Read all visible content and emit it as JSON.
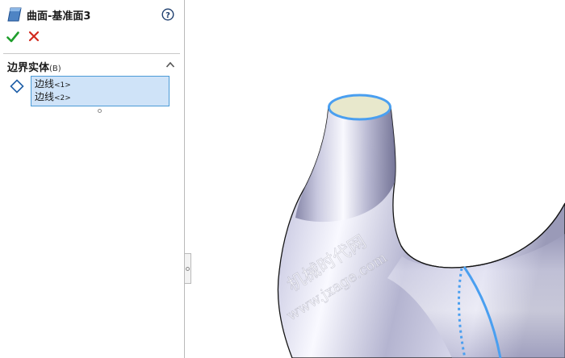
{
  "window": {
    "title": "曲面-基准面3",
    "help_icon": "question-circle-icon",
    "feature_icon": "surface-plane-icon"
  },
  "actions": {
    "ok_icon": "checkmark-icon",
    "ok_color": "#1f9e2c",
    "cancel_icon": "x-icon",
    "cancel_color": "#d22a1e"
  },
  "section": {
    "title": "边界实体",
    "hotkey": "(B)",
    "collapse_icon": "chevron-up-icon",
    "edge_icon": "diamond-edge-icon",
    "items": [
      {
        "name": "边线",
        "tag": "<1>"
      },
      {
        "name": "边线",
        "tag": "<2>"
      }
    ]
  },
  "viewport": {
    "watermark_line1": "机械时代网",
    "watermark_line2": "www.jxage.com",
    "edge_highlight_color": "#4a9ff0"
  }
}
